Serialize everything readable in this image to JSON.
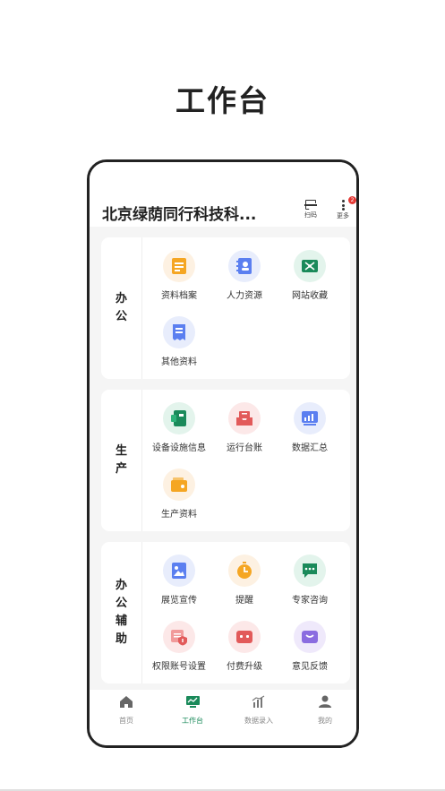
{
  "page": {
    "title": "工作台"
  },
  "header": {
    "company_name": "北京绿荫同行科技科...",
    "scan_label": "扫码",
    "more_label": "更多",
    "more_badge": "2"
  },
  "sections": [
    {
      "category": [
        "办",
        "公"
      ],
      "items": [
        {
          "label": "资料档案",
          "icon": "document-archive-icon"
        },
        {
          "label": "人力资源",
          "icon": "contacts-book-icon"
        },
        {
          "label": "网站收藏",
          "icon": "bookmark-folder-icon"
        },
        {
          "label": "其他资料",
          "icon": "receipt-icon"
        }
      ]
    },
    {
      "category": [
        "生",
        "产"
      ],
      "items": [
        {
          "label": "设备设施信息",
          "icon": "device-card-icon"
        },
        {
          "label": "运行台账",
          "icon": "ledger-tray-icon"
        },
        {
          "label": "数据汇总",
          "icon": "chart-summary-icon"
        },
        {
          "label": "生产资料",
          "icon": "wallet-icon"
        }
      ]
    },
    {
      "category": [
        "办",
        "公",
        "辅",
        "助"
      ],
      "items": [
        {
          "label": "展览宣传",
          "icon": "picture-icon"
        },
        {
          "label": "提醒",
          "icon": "timer-icon"
        },
        {
          "label": "专家咨询",
          "icon": "chat-bubble-icon"
        },
        {
          "label": "权限账号设置",
          "icon": "shield-account-icon"
        },
        {
          "label": "付费升级",
          "icon": "purse-icon"
        },
        {
          "label": "意见反馈",
          "icon": "feedback-tray-icon"
        }
      ]
    }
  ],
  "tabs": [
    {
      "label": "首页",
      "icon": "home-icon",
      "active": false
    },
    {
      "label": "工作台",
      "icon": "monitor-chart-icon",
      "active": true
    },
    {
      "label": "数据录入",
      "icon": "bar-chart-icon",
      "active": false
    },
    {
      "label": "我的",
      "icon": "person-icon",
      "active": false
    }
  ],
  "colors": {
    "accent_green": "#1a8a5a",
    "orange": "#f5a623",
    "blue": "#5b7ff0",
    "red": "#e25a5a",
    "purple": "#8a6ce0"
  }
}
